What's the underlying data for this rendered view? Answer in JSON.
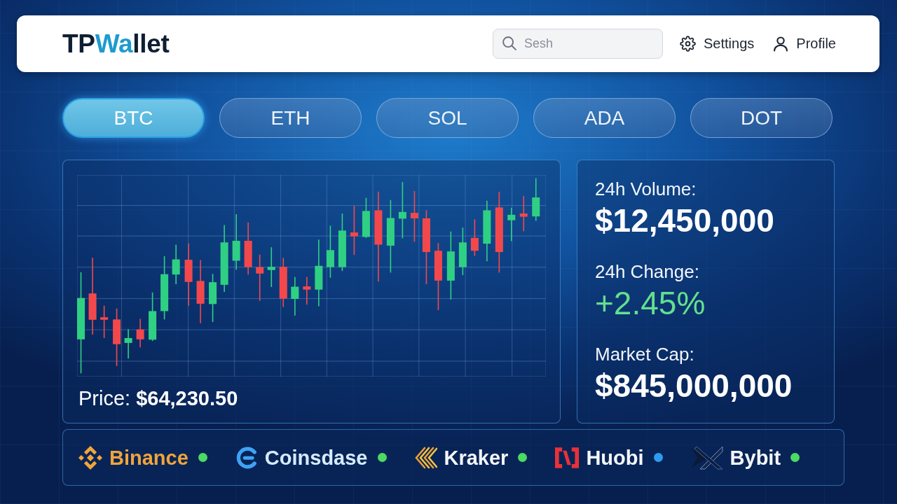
{
  "header": {
    "logo": [
      {
        "text": "TP",
        "accent": false
      },
      {
        "text": "Wa",
        "accent": true
      },
      {
        "text": "llet",
        "accent": false
      }
    ],
    "search": {
      "placeholder": "Sesh"
    },
    "actions": [
      {
        "kind": "settings",
        "label": "Settings"
      },
      {
        "kind": "profile",
        "label": "Profile"
      }
    ]
  },
  "tabs": [
    {
      "label": "BTC",
      "selected": true
    },
    {
      "label": "ETH",
      "selected": false
    },
    {
      "label": "SOL",
      "selected": false
    },
    {
      "label": "ADA",
      "selected": false
    },
    {
      "label": "DOT",
      "selected": false
    }
  ],
  "chart_panel": {
    "price": {
      "label": "Price:",
      "value": "$64,230.50"
    }
  },
  "stats": [
    {
      "label": "24h Volume:",
      "value": "$12,450,000",
      "kind": "amount"
    },
    {
      "label": "24h Change:",
      "value": "+2.45%",
      "kind": "gain"
    },
    {
      "label": "Market Cap:",
      "value": "$845,000,000",
      "kind": "amount"
    }
  ],
  "exchanges": [
    {
      "kind": "diamond",
      "name": "Binance",
      "color": "#4cd964"
    },
    {
      "kind": "ring",
      "name": "Coinsdase",
      "color": "#4cd964"
    },
    {
      "kind": "stripes",
      "name": "Kraker",
      "color": "#4cd964"
    },
    {
      "kind": "bracket",
      "name": "Huobi",
      "color": "#2f9bf0"
    },
    {
      "kind": "wings",
      "name": "Bybit",
      "color": "#4cd964"
    }
  ]
}
